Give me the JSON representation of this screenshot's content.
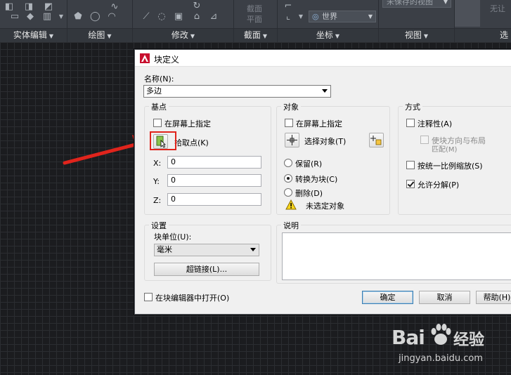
{
  "ribbon": {
    "panels": [
      {
        "title": "实体编辑"
      },
      {
        "title": "绘图"
      },
      {
        "title": "修改"
      },
      {
        "title": "截面"
      },
      {
        "title": "坐标"
      },
      {
        "title": "视图"
      },
      {
        "title": "选"
      }
    ],
    "section_text": "截面",
    "plane_text": "平面",
    "world_combo": "世界",
    "view_combo": "未保存的视图",
    "right_text": "无让"
  },
  "dialog": {
    "title": "块定义",
    "name_label": "名称(N):",
    "name_value": "多边",
    "basepoint": {
      "title": "基点",
      "specify_on_screen": "在屏幕上指定",
      "pick_point": "拾取点(K)",
      "x_label": "X:",
      "x_value": "0",
      "y_label": "Y:",
      "y_value": "0",
      "z_label": "Z:",
      "z_value": "0"
    },
    "objects": {
      "title": "对象",
      "specify_on_screen": "在屏幕上指定",
      "select_objects": "选择对象(T)",
      "retain": "保留(R)",
      "convert_to_block": "转换为块(C)",
      "delete": "删除(D)",
      "warning": "未选定对象"
    },
    "behavior": {
      "title": "方式",
      "annotative": "注释性(A)",
      "match_orientation_line1": "使块方向与布局",
      "match_orientation_line2": "匹配(M)",
      "scale_uniformly": "按统一比例缩放(S)",
      "allow_exploding": "允许分解(P)"
    },
    "settings": {
      "title": "设置",
      "block_unit_label": "块单位(U):",
      "block_unit_value": "毫米",
      "hyperlink_button": "超链接(L)..."
    },
    "description": {
      "title": "说明"
    },
    "open_in_editor": "在块编辑器中打开(O)",
    "ok_button": "确定",
    "cancel_button": "取消",
    "help_button": "帮助(H)"
  },
  "watermark": {
    "brand_left": "Bai",
    "brand_right": "经验",
    "url": "jingyan.baidu.com"
  },
  "colors": {
    "canvas": "#1b1c1f",
    "ribbon": "#3b3f46",
    "annotation_red": "#e0241c",
    "default_button_border": "#3c7fb1"
  }
}
